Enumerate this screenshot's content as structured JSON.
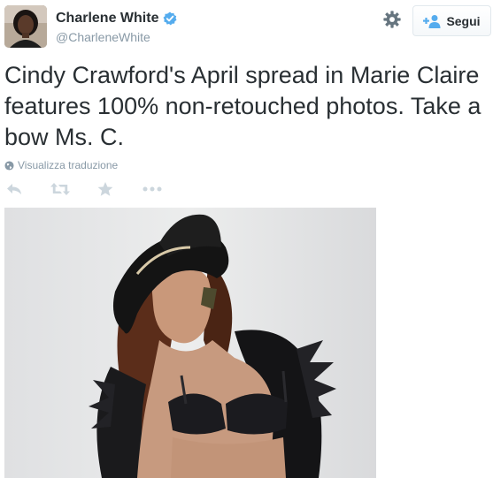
{
  "user": {
    "display_name": "Charlene White",
    "handle": "@CharleneWhite",
    "verified_icon": "verified-badge-icon"
  },
  "header": {
    "settings_icon": "gear-icon",
    "follow_label": "Segui",
    "follow_icon": "add-user-icon"
  },
  "tweet": {
    "text": "Cindy Crawford's April spread in Marie Claire features 100% non-retouched photos. Take a bow Ms. C.",
    "translate_label": "Visualizza traduzione",
    "translate_icon": "globe-icon"
  },
  "actions": [
    {
      "icon": "reply-icon"
    },
    {
      "icon": "retweet-icon"
    },
    {
      "icon": "favorite-star-icon"
    },
    {
      "icon": "more-icon"
    }
  ],
  "colors": {
    "text": "#292f33",
    "muted": "#8899a6",
    "verified": "#55acee",
    "action_icons": "#ccd6dd"
  }
}
